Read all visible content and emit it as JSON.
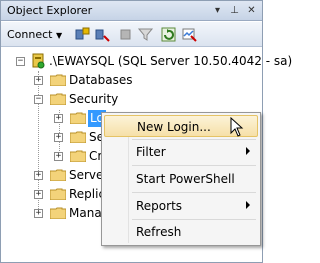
{
  "window": {
    "title": "Object Explorer",
    "pin_glyph": "⊥",
    "close_glyph": "✕",
    "dropdown_glyph": "▾"
  },
  "toolbar": {
    "connect_label": "Connect",
    "icons": [
      "connect-object-explorer-icon",
      "disconnect-icon",
      "stop-icon",
      "filter-icon",
      "refresh-icon",
      "activity-monitor-icon"
    ]
  },
  "tree": {
    "server": ".\\EWAYSQL (SQL Server 10.50.4042 - sa)",
    "databases": "Databases",
    "security": "Security",
    "logins": "Lo",
    "security_child2": "Se",
    "security_child3": "Cr",
    "server_objects": "Server",
    "replication": "Replic",
    "management": "Manag"
  },
  "context_menu": {
    "new_login": "New Login...",
    "filter": "Filter",
    "start_powershell": "Start PowerShell",
    "reports": "Reports",
    "refresh": "Refresh"
  }
}
